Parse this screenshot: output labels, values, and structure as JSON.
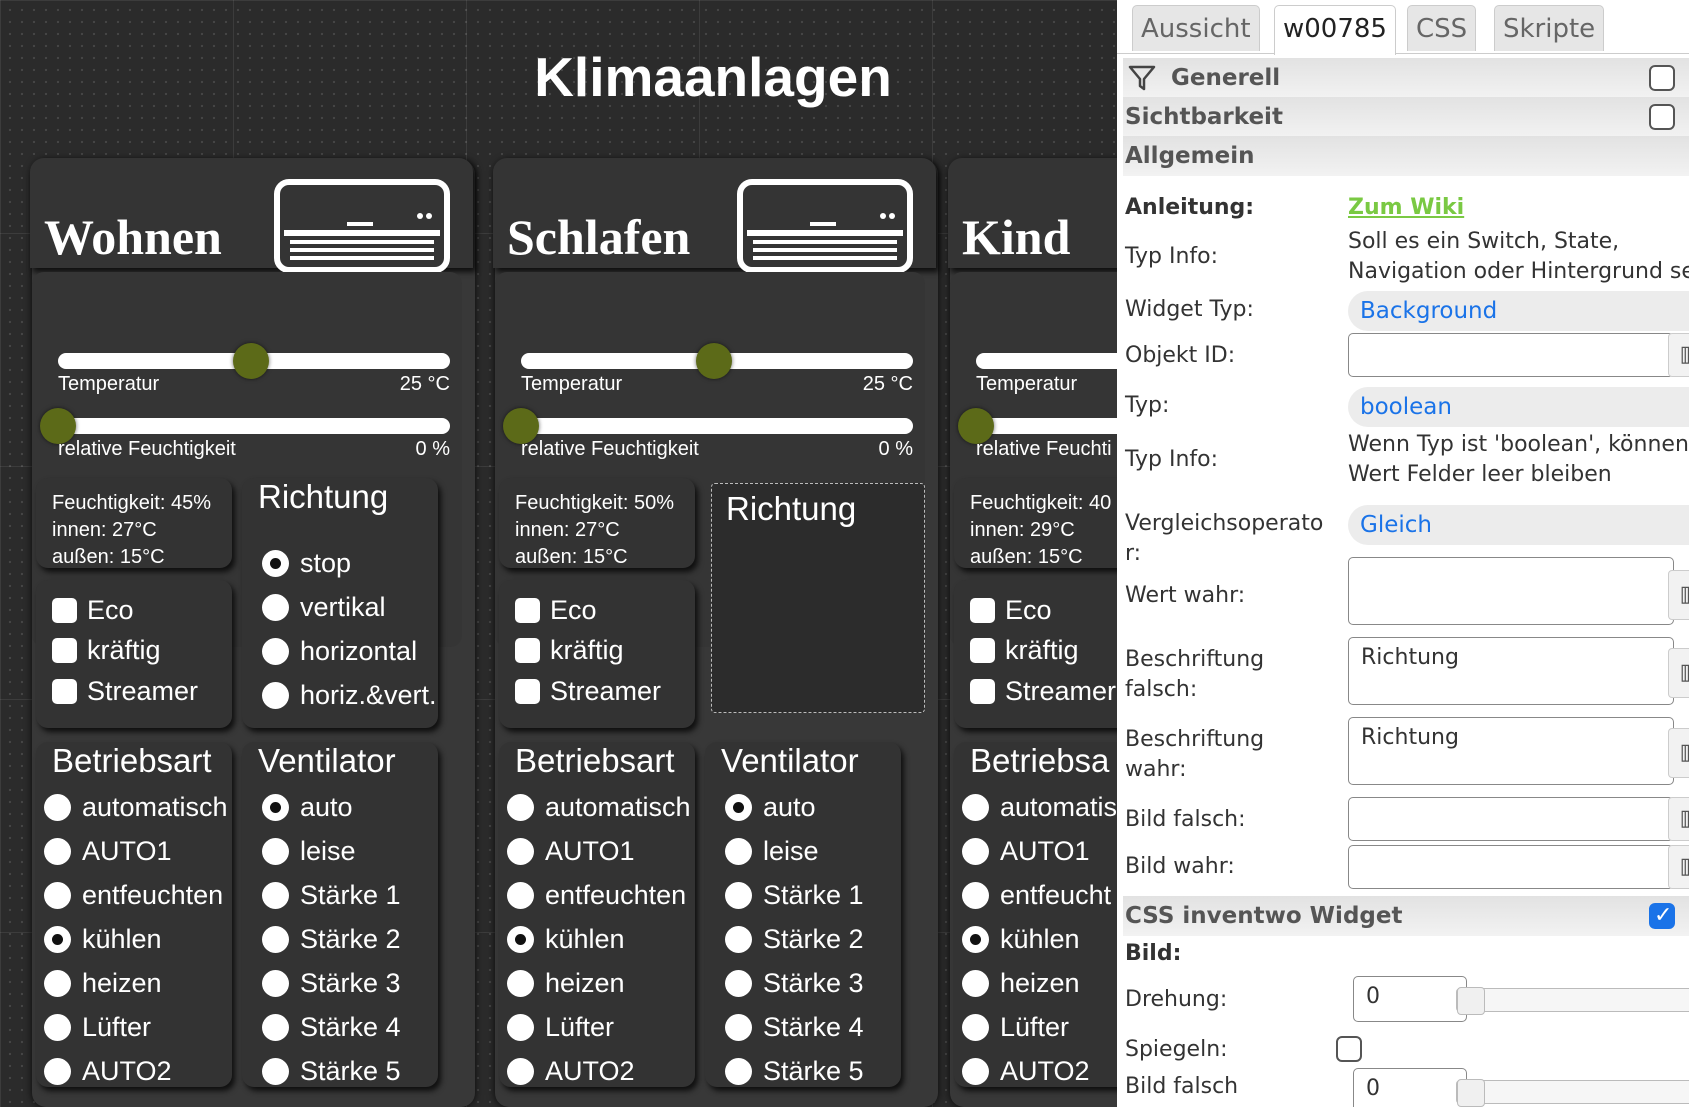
{
  "view": {
    "title": "Klimaanlagen"
  },
  "rooms": [
    {
      "name": "Wohnen",
      "temp_label": "Temperatur",
      "temp_value": "25 °C",
      "temp_fraction": 0.6,
      "hum_label": "relative Feuchtigkeit",
      "hum_value": "0 %",
      "hum_fraction": 0.0,
      "info": [
        "Feuchtigkeit: 45%",
        "innen: 27°C",
        "außen: 15°C"
      ],
      "direction": {
        "title": "Richtung",
        "options": [
          "stop",
          "vertikal",
          "horizontal",
          "horiz.&vert."
        ],
        "selected": 0
      },
      "extras": [
        "Eco",
        "kräftig",
        "Streamer"
      ],
      "mode": {
        "title": "Betriebsart",
        "options": [
          "automatisch",
          "AUTO1",
          "entfeuchten",
          "kühlen",
          "heizen",
          "Lüfter",
          "AUTO2"
        ],
        "selected": 3
      },
      "fan": {
        "title": "Ventilator",
        "options": [
          "auto",
          "leise",
          "Stärke 1",
          "Stärke 2",
          "Stärke 3",
          "Stärke 4",
          "Stärke 5"
        ],
        "selected": 0
      }
    },
    {
      "name": "Schlafen",
      "temp_label": "Temperatur",
      "temp_value": "25 °C",
      "temp_fraction": 0.6,
      "hum_label": "relative Feuchtigkeit",
      "hum_value": "0 %",
      "hum_fraction": 0.0,
      "info": [
        "Feuchtigkeit: 50%",
        "innen: 27°C",
        "außen: 15°C"
      ],
      "direction": {
        "title": "Richtung",
        "options": [],
        "selected": -1
      },
      "extras": [
        "Eco",
        "kräftig",
        "Streamer"
      ],
      "mode": {
        "title": "Betriebsart",
        "options": [
          "automatisch",
          "AUTO1",
          "entfeuchten",
          "kühlen",
          "heizen",
          "Lüfter",
          "AUTO2"
        ],
        "selected": 3
      },
      "fan": {
        "title": "Ventilator",
        "options": [
          "auto",
          "leise",
          "Stärke 1",
          "Stärke 2",
          "Stärke 3",
          "Stärke 4",
          "Stärke 5"
        ],
        "selected": 0
      }
    },
    {
      "name": "Kind",
      "temp_label": "Temperatur",
      "temp_value": "",
      "temp_fraction": 0.6,
      "hum_label": "relative Feuchti",
      "hum_value": "",
      "hum_fraction": 0.0,
      "info": [
        "Feuchtigkeit: 40",
        "innen: 29°C",
        "außen: 15°C"
      ],
      "direction": {
        "title": "",
        "options": [],
        "selected": -1
      },
      "extras": [
        "Eco",
        "kräftig",
        "Streamer"
      ],
      "mode": {
        "title": "Betriebsa",
        "options": [
          "automatis",
          "AUTO1",
          "entfeucht",
          "kühlen",
          "heizen",
          "Lüfter",
          "AUTO2"
        ],
        "selected": 3
      },
      "fan": {
        "title": "",
        "options": [],
        "selected": -1
      }
    }
  ],
  "inspector": {
    "tabs": [
      "Aussicht",
      "w00785",
      "CSS",
      "Skripte"
    ],
    "active_tab": 1,
    "groups": {
      "generell": "Generell",
      "sichtbarkeit": "Sichtbarkeit",
      "allgemein": "Allgemein",
      "css_widget": "CSS inventwo Widget"
    },
    "css_widget_checked": true,
    "anleitung_label": "Anleitung:",
    "anleitung_link": "Zum Wiki",
    "typinfo_label": "Typ Info:",
    "typinfo_text": [
      "Soll es ein Switch, State,",
      "Navigation oder Hintergrund se"
    ],
    "widget_type_label": "Widget Typ:",
    "widget_type": "Background",
    "object_id_label": "Objekt ID:",
    "object_id": "",
    "typ_label": "Typ:",
    "typ": "boolean",
    "typinfo2_label": "Typ Info:",
    "typinfo2_text": [
      "Wenn Typ ist 'boolean', können",
      "Wert Felder leer bleiben"
    ],
    "vergleich_label": [
      "Vergleichsoperato",
      "r:"
    ],
    "vergleich": "Gleich",
    "wert_wahr_label": "Wert wahr:",
    "wert_wahr": "",
    "beschr_falsch_label": [
      "Beschriftung",
      "falsch:"
    ],
    "beschr_falsch": "Richtung",
    "beschr_wahr_label": [
      "Beschriftung",
      "wahr:"
    ],
    "beschr_wahr": "Richtung",
    "bild_falsch_label": "Bild falsch:",
    "bild_wahr_label": "Bild wahr:",
    "bild_label": "Bild:",
    "drehung_label": "Drehung:",
    "drehung": "0",
    "spiegeln_label": "Spiegeln:",
    "bild_falsch2_label": "Bild falsch",
    "bild_falsch2": "0",
    "button_glyph": "▥",
    "filter_icon": "filter-icon"
  }
}
